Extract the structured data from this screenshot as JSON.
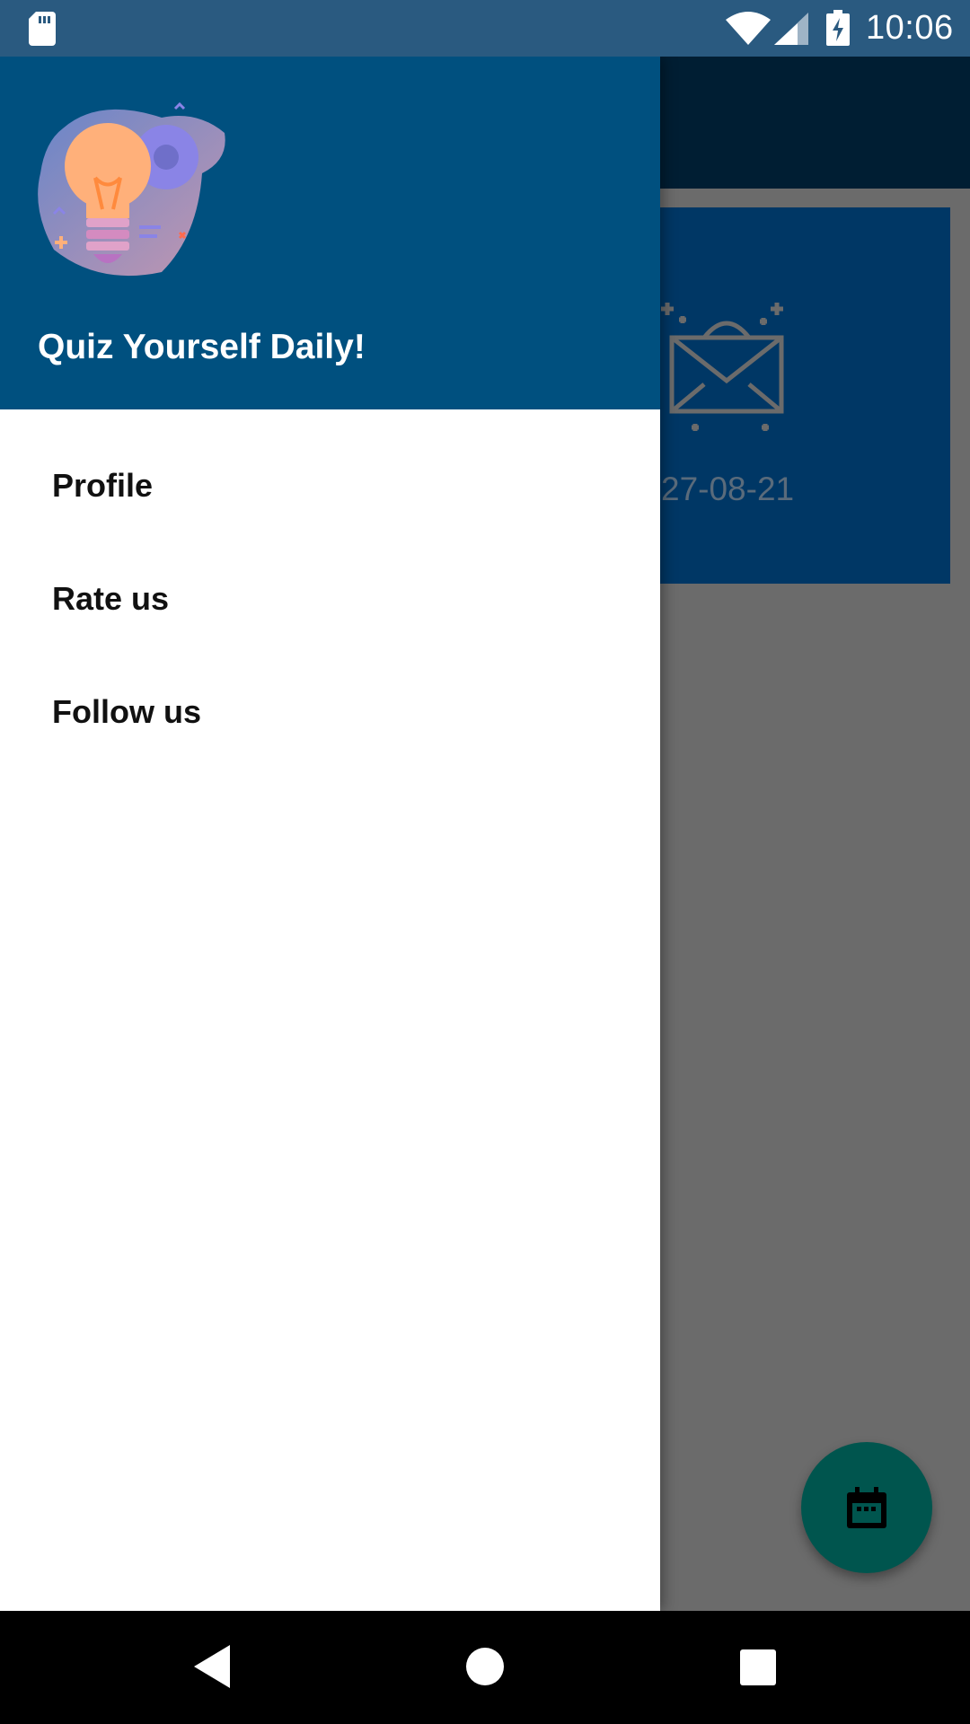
{
  "status_bar": {
    "time": "10:06",
    "icons": [
      "sd-card-icon",
      "wifi-icon",
      "signal-icon",
      "battery-charging-icon"
    ]
  },
  "drawer": {
    "header_title": "Quiz Yourself Daily!",
    "logo_icon": "lightbulb-gear-icon",
    "menu": [
      {
        "label": "Profile"
      },
      {
        "label": "Rate us"
      },
      {
        "label": "Follow us"
      }
    ]
  },
  "background_app": {
    "card": {
      "icon": "mail-bag-icon",
      "date": "27-08-21"
    },
    "fab_icon": "calendar-icon"
  },
  "nav_bar": {
    "icons": [
      "back-icon",
      "home-icon",
      "recents-icon"
    ]
  },
  "colors": {
    "status_bar": "#2a5a80",
    "drawer_header": "#00507f",
    "fab": "#00554e",
    "scrim": "#6b6b6b"
  }
}
